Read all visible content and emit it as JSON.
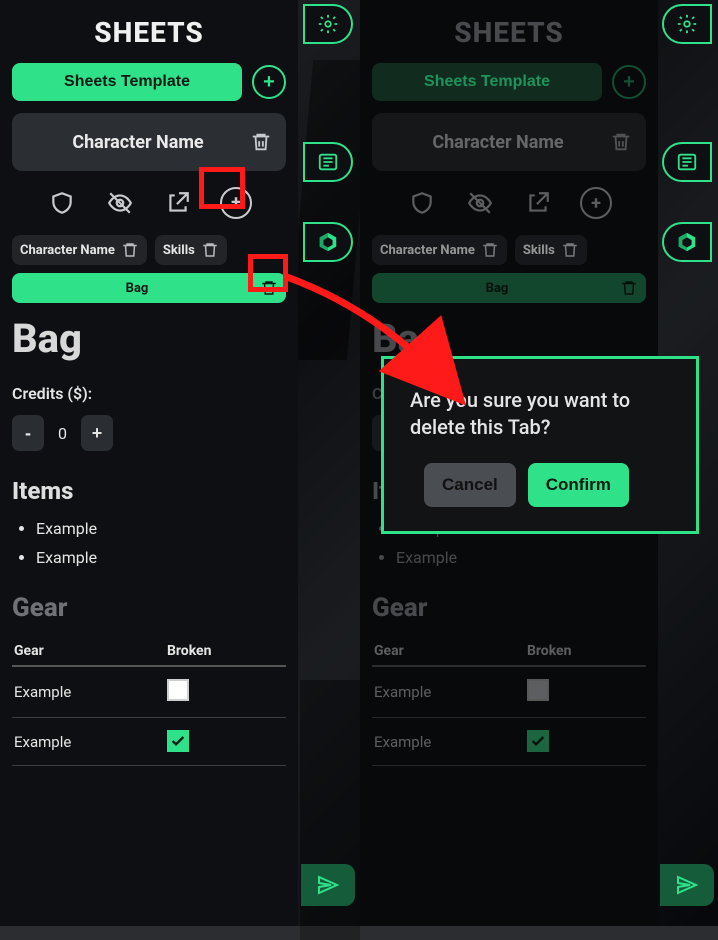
{
  "colors": {
    "accent": "#2fe28a",
    "red": "#ff1a1a"
  },
  "header": {
    "title": "SHEETS",
    "template_btn": "Sheets Template"
  },
  "character": {
    "name_label": "Character Name"
  },
  "tabs": {
    "char": "Character Name",
    "skills": "Skills",
    "bag": "Bag"
  },
  "page": {
    "title": "Bag",
    "credits_label": "Credits ($):",
    "credits_value": "0",
    "items_heading": "Items",
    "items": [
      "Example",
      "Example"
    ],
    "gear_heading": "Gear",
    "gear_cols": {
      "name": "Gear",
      "broken": "Broken"
    },
    "gear_rows": [
      {
        "name": "Example",
        "broken": false
      },
      {
        "name": "Example",
        "broken": true
      }
    ]
  },
  "modal": {
    "text": "Are you sure you want to delete this Tab?",
    "cancel": "Cancel",
    "confirm": "Confirm"
  },
  "icons": {
    "plus": "+",
    "minus": "-"
  }
}
